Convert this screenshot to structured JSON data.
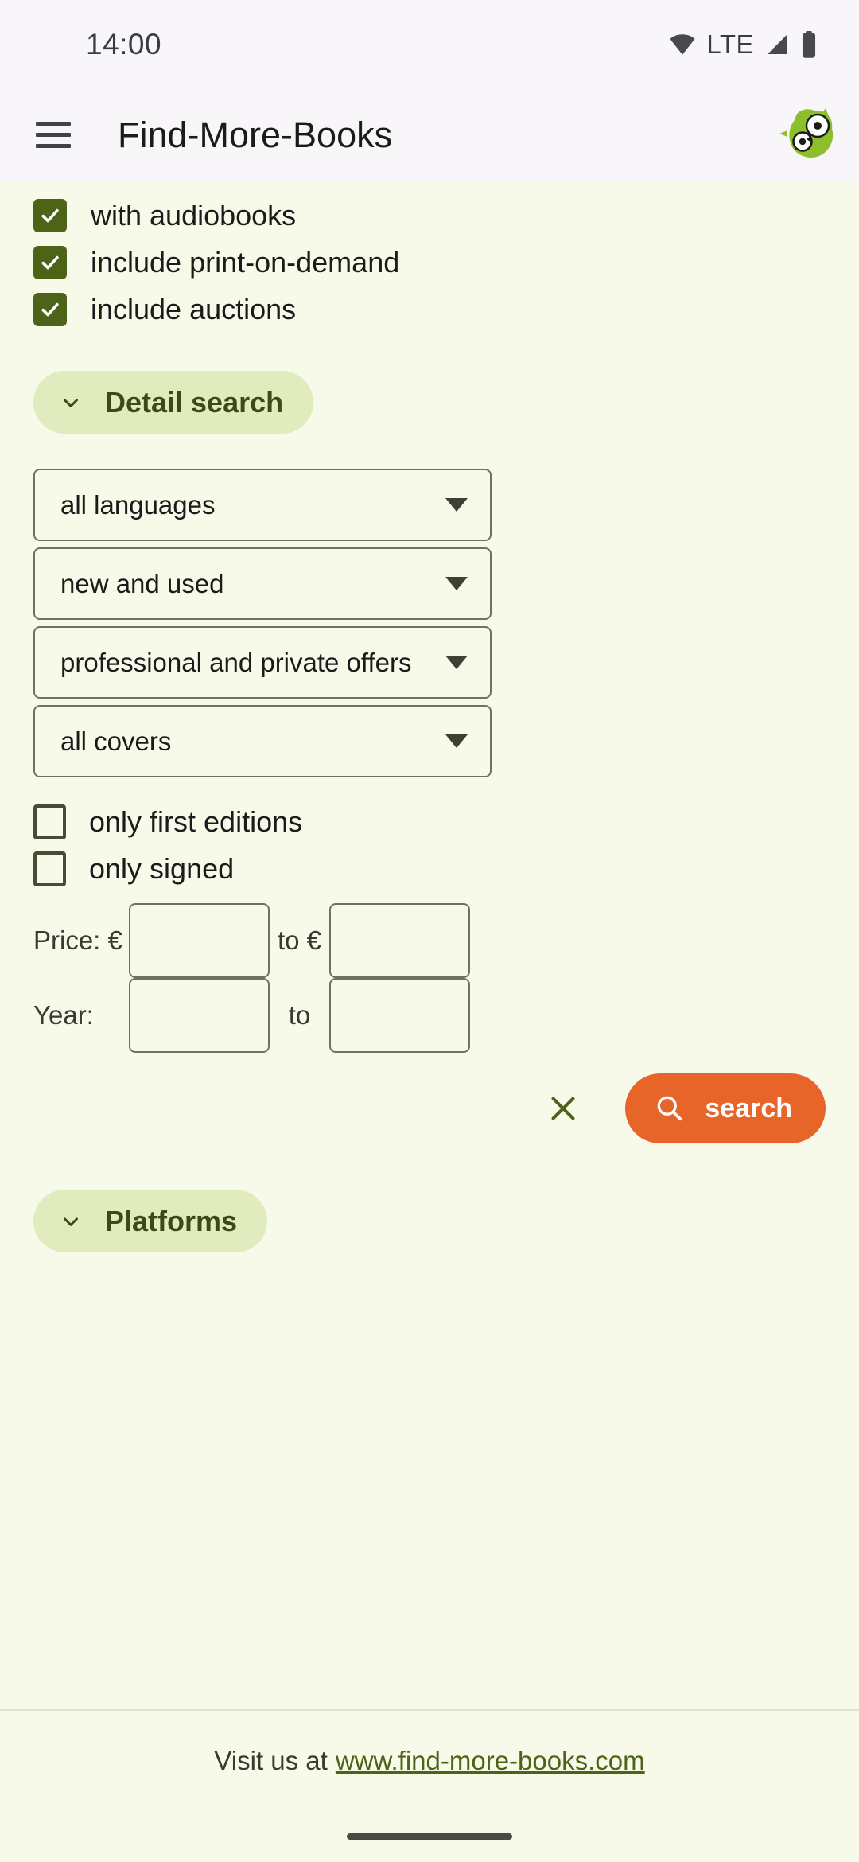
{
  "status_bar": {
    "time": "14:00",
    "network_label": "LTE",
    "icons": [
      "wifi-icon",
      "cellular-signal-icon",
      "battery-icon"
    ]
  },
  "app_bar": {
    "menu_icon": "hamburger-menu-icon",
    "title": "Find-More-Books",
    "logo": "owl-logo-icon"
  },
  "filters": {
    "checked_options": [
      {
        "label": "with audiobooks",
        "checked": true
      },
      {
        "label": "include print-on-demand",
        "checked": true
      },
      {
        "label": "include auctions",
        "checked": true
      }
    ],
    "detail_search": {
      "label": "Detail search",
      "icon": "chevron-down-icon",
      "expanded": true
    },
    "selects": [
      {
        "name": "language",
        "value": "all languages",
        "icon": "dropdown-arrow-icon"
      },
      {
        "name": "condition",
        "value": "new and used",
        "icon": "dropdown-arrow-icon"
      },
      {
        "name": "seller-type",
        "value": "professional and private offers",
        "icon": "dropdown-arrow-icon"
      },
      {
        "name": "cover",
        "value": "all covers",
        "icon": "dropdown-arrow-icon"
      }
    ],
    "unchecked_options": [
      {
        "label": "only first editions",
        "checked": false
      },
      {
        "label": "only signed",
        "checked": false
      }
    ],
    "price_range": {
      "label": "Price: €",
      "from_value": "",
      "from_placeholder": "",
      "separator": "to €",
      "to_value": "",
      "to_placeholder": ""
    },
    "year_range": {
      "label": "Year:",
      "from_value": "",
      "from_placeholder": "",
      "separator": "to",
      "to_value": "",
      "to_placeholder": ""
    },
    "actions": {
      "clear_icon": "close-x-icon",
      "search_icon": "search-icon",
      "search_label": "search"
    },
    "platforms": {
      "label": "Platforms",
      "icon": "chevron-down-icon",
      "expanded": false
    }
  },
  "footer": {
    "text": "Visit us at",
    "link": "www.find-more-books.com"
  },
  "colors": {
    "page_background": "#f7fae9",
    "app_bar_background": "#f8f6f9",
    "checkbox_checked": "#4d6318",
    "chip_background": "#e0ebbe",
    "chip_text": "#3e4a16",
    "search_button": "#e8652a",
    "link": "#4d6318",
    "field_border": "#70735b"
  }
}
